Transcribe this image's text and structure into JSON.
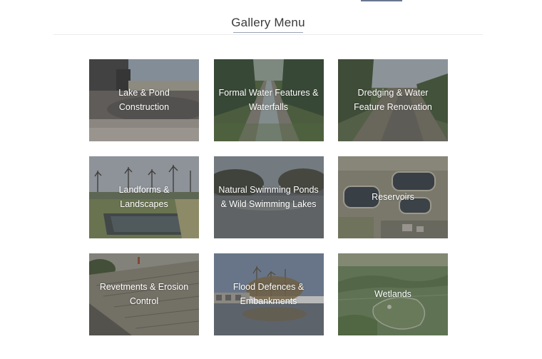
{
  "gallery": {
    "title": "Gallery Menu",
    "items": [
      {
        "label": "Lake & Pond Construction",
        "line1": "Lake & Pond",
        "line2": "Construction"
      },
      {
        "label": "Formal Water Features & Waterfalls",
        "line1": "Formal Water Features &",
        "line2": "Waterfalls"
      },
      {
        "label": "Dredging & Water Feature Renovation",
        "line1": "Dredging & Water",
        "line2": "Feature Renovation"
      },
      {
        "label": "Landforms & Landscapes",
        "line1": "Landforms &",
        "line2": "Landscapes"
      },
      {
        "label": "Natural Swimming Ponds & Wild Swimming Lakes",
        "line1": "Natural Swimming Ponds",
        "line2": "& Wild Swimming Lakes"
      },
      {
        "label": "Reservoirs",
        "line1": "Reservoirs",
        "line2": ""
      },
      {
        "label": "Revetments & Erosion Control",
        "line1": "Revetments & Erosion",
        "line2": "Control"
      },
      {
        "label": "Flood Defences & Embankments",
        "line1": "Flood Defences &",
        "line2": "Embankments"
      },
      {
        "label": "Wetlands",
        "line1": "Wetlands",
        "line2": ""
      }
    ]
  },
  "colors": {
    "title_text": "#3a3a3a",
    "accent": "#6b7690",
    "divider": "#ececec",
    "tile_text": "#ffffff"
  }
}
